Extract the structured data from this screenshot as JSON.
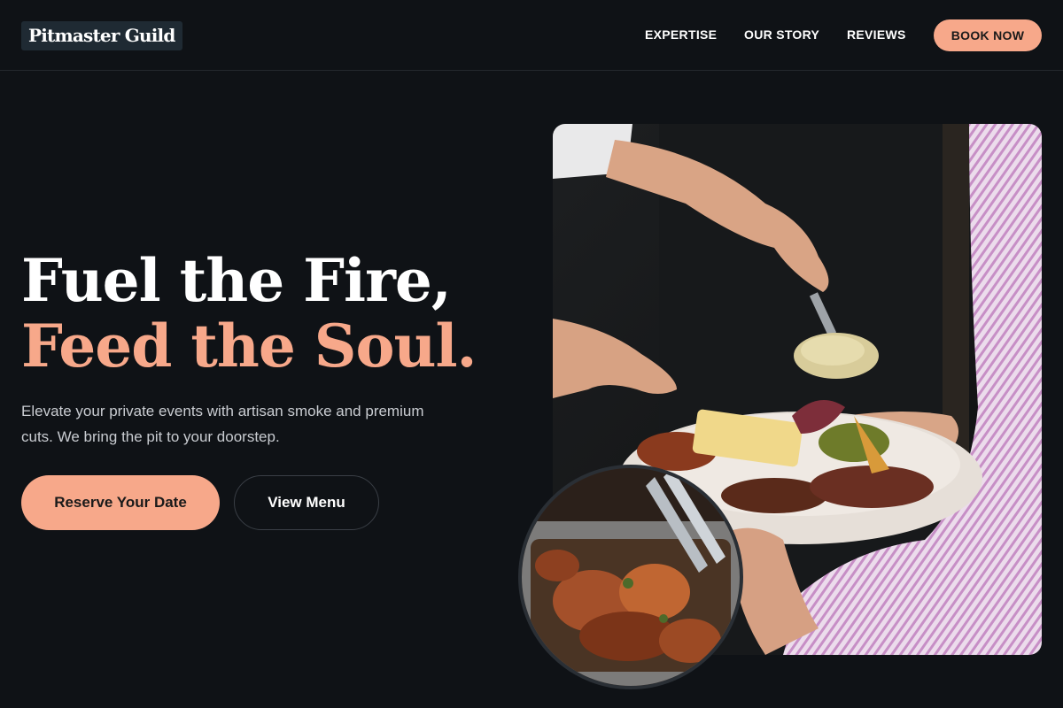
{
  "brand": {
    "name": "Pitmaster Guild"
  },
  "nav": {
    "items": [
      {
        "label": "EXPERTISE"
      },
      {
        "label": "OUR STORY"
      },
      {
        "label": "REVIEWS"
      }
    ],
    "cta_label": "BOOK NOW"
  },
  "hero": {
    "headline_line1": "Fuel the Fire,",
    "headline_line2": "Feed the Soul.",
    "subtext": "Elevate your private events with artisan smoke and premium cuts. We bring the pit to your doorstep.",
    "primary_button": "Reserve Your Date",
    "secondary_button": "View Menu"
  },
  "colors": {
    "background": "#0f1216",
    "accent": "#f7a88a",
    "text_muted": "#c9ccd1"
  }
}
